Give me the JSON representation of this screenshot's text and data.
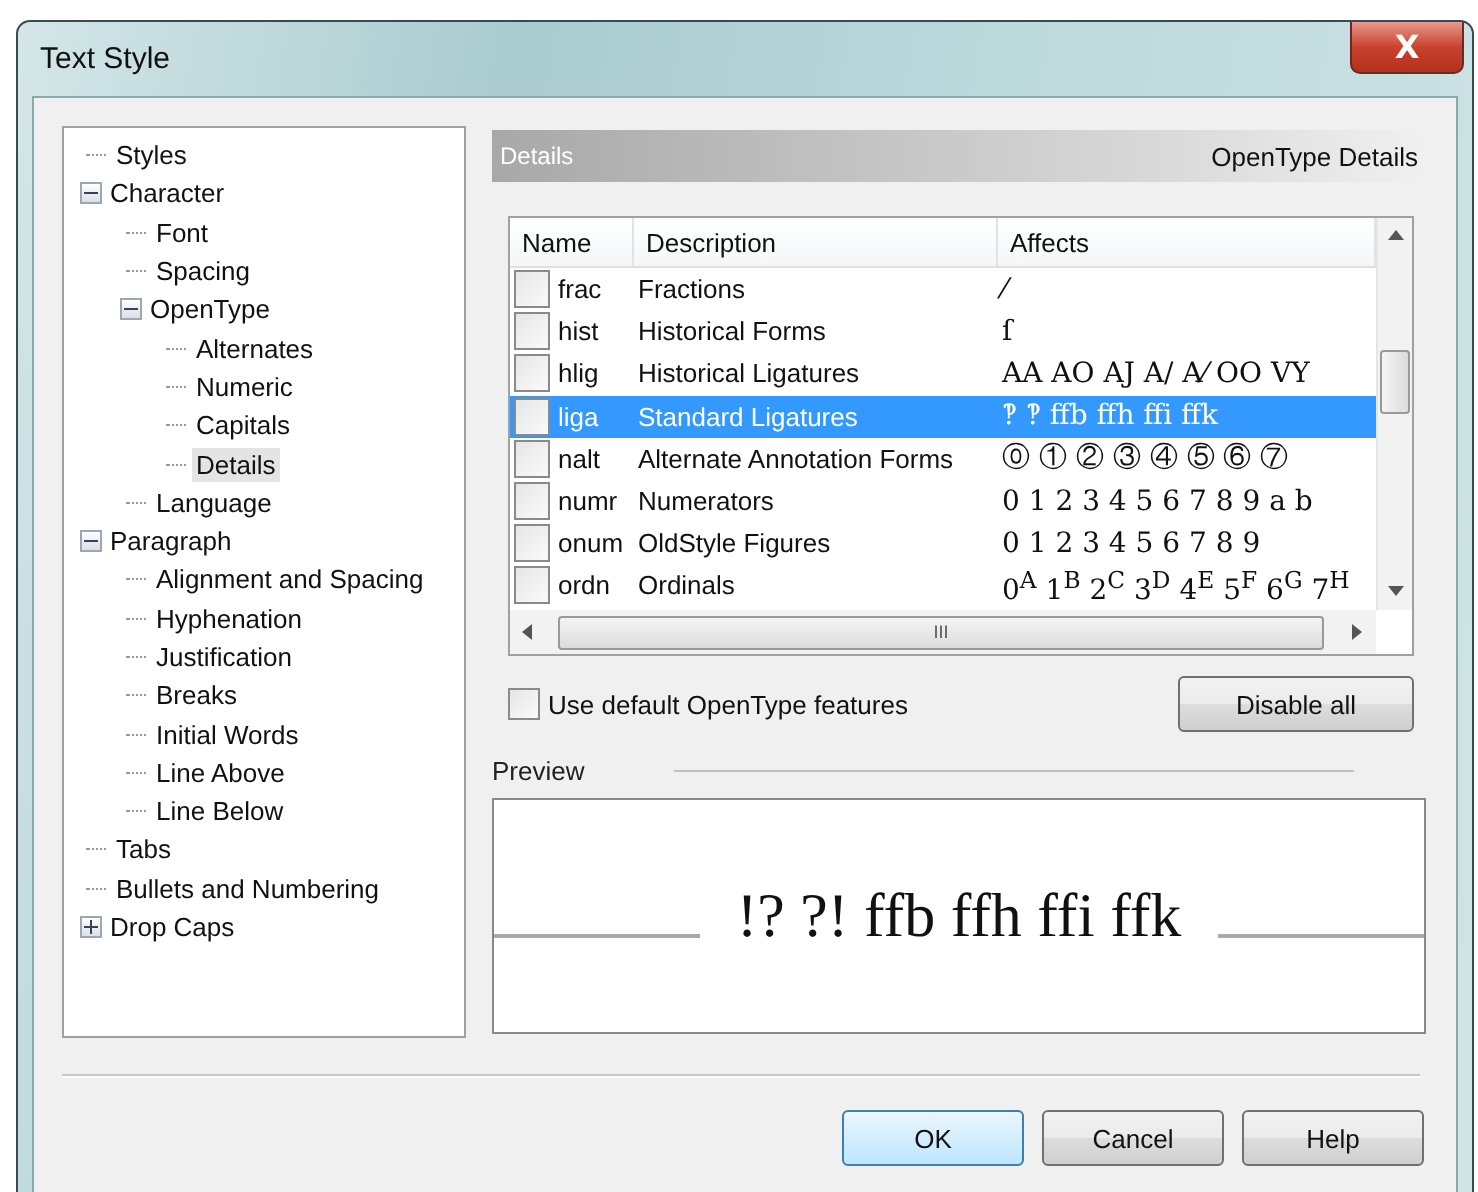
{
  "window": {
    "title": "Text Style",
    "close": "X"
  },
  "tree": [
    {
      "label": "Styles",
      "selected": false
    },
    {
      "label": "Character",
      "selected": false,
      "expanded": true,
      "children": [
        {
          "label": "Font",
          "selected": false
        },
        {
          "label": "Spacing",
          "selected": false
        },
        {
          "label": "OpenType",
          "selected": false,
          "expanded": true,
          "children": [
            {
              "label": "Alternates",
              "selected": false
            },
            {
              "label": "Numeric",
              "selected": false
            },
            {
              "label": "Capitals",
              "selected": false
            },
            {
              "label": "Details",
              "selected": true
            }
          ]
        },
        {
          "label": "Language",
          "selected": false
        }
      ]
    },
    {
      "label": "Paragraph",
      "selected": false,
      "expanded": true,
      "children": [
        {
          "label": "Alignment and Spacing",
          "selected": false
        },
        {
          "label": "Hyphenation",
          "selected": false
        },
        {
          "label": "Justification",
          "selected": false
        },
        {
          "label": "Breaks",
          "selected": false
        },
        {
          "label": "Initial Words",
          "selected": false
        },
        {
          "label": "Line Above",
          "selected": false
        },
        {
          "label": "Line Below",
          "selected": false
        }
      ]
    },
    {
      "label": "Tabs",
      "selected": false
    },
    {
      "label": "Bullets and Numbering",
      "selected": false
    },
    {
      "label": "Drop Caps",
      "selected": false,
      "expanded": false
    }
  ],
  "header": {
    "title": "Details",
    "subtitle": "OpenType Details"
  },
  "table": {
    "columns": [
      "Name",
      "Description",
      "Affects"
    ],
    "rows": [
      {
        "name": "frac",
        "description": "Fractions",
        "affects": "⁄",
        "checked": false,
        "selected": false
      },
      {
        "name": "hist",
        "description": "Historical Forms",
        "affects": "ſ",
        "checked": false,
        "selected": false
      },
      {
        "name": "hlig",
        "description": "Historical Ligatures",
        "affects": "AA AO AJ A/ A⁄ OO VY",
        "checked": false,
        "selected": false
      },
      {
        "name": "liga",
        "description": "Standard Ligatures",
        "affects": "‽ ‽ ffb ffh ffi ffk",
        "checked": false,
        "selected": true
      },
      {
        "name": "nalt",
        "description": "Alternate Annotation Forms",
        "affects": "⓪ ① ② ③ ④ ⑤ ⑥ ⑦",
        "checked": false,
        "selected": false
      },
      {
        "name": "numr",
        "description": "Numerators",
        "affects": "0 1 2 3 4 5 6 7 8 9 a b",
        "checked": false,
        "selected": false
      },
      {
        "name": "onum",
        "description": "OldStyle Figures",
        "affects": "0 1 2 3 4 5 6 7 8 9",
        "checked": false,
        "selected": false
      },
      {
        "name": "ordn",
        "description": "Ordinals",
        "affects": "0$^{A}$ 1$^{B}$ 2$^{C}$ 3$^{D}$ 4$^{E}$ 5$^{F}$ 6$^{G}$ 7$^{H}$",
        "checked": false,
        "selected": false
      }
    ],
    "hscroll_grip": "III"
  },
  "default_features": {
    "label": "Use default OpenType features",
    "checked": false
  },
  "disable_button": "Disable all",
  "preview": {
    "label": "Preview",
    "sample": "!? ?! ffb ffh ffi ffk"
  },
  "buttons": [
    "OK",
    "Cancel",
    "Help"
  ]
}
